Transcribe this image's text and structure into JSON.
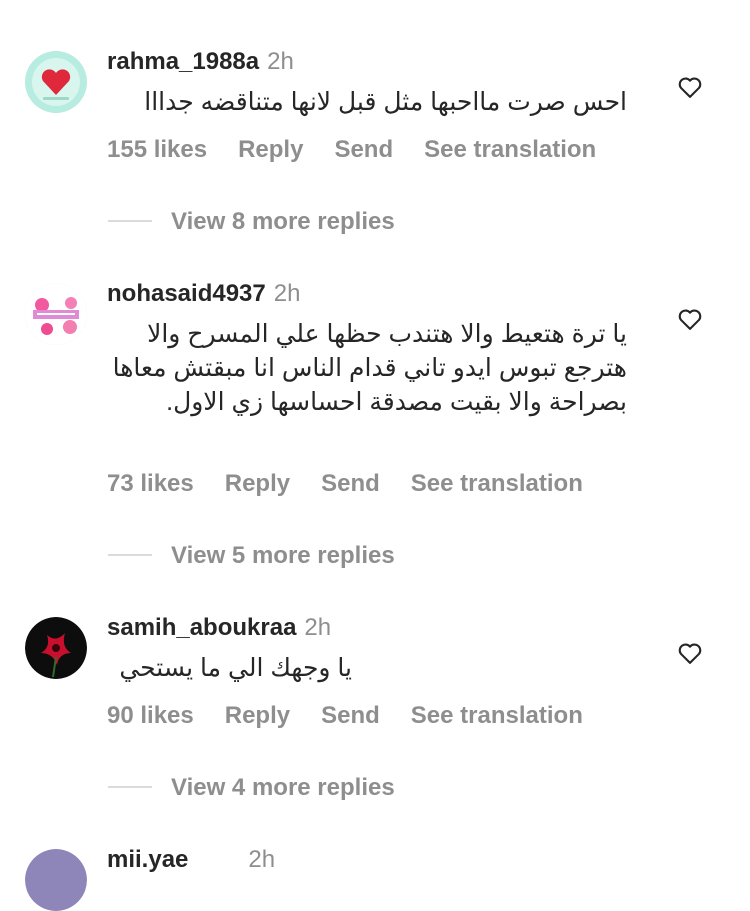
{
  "comments": [
    {
      "username": "rahma_1988a",
      "time": "2h",
      "text": "احس صرت مااحبها مثل قبل لانها متناقضه جدااا",
      "likes": "155 likes",
      "reply": "Reply",
      "send": "Send",
      "translate": "See translation",
      "view_replies": "View 8 more replies"
    },
    {
      "username": "nohasaid4937",
      "time": "2h",
      "text": "يا ترة هتعيط والا هتندب حظها علي المسرح والا هترجع تبوس ايدو تاني قدام الناس انا مبقتش معاها بصراحة والا بقيت مصدقة احساسها زي الاول.",
      "likes": "73 likes",
      "reply": "Reply",
      "send": "Send",
      "translate": "See translation",
      "view_replies": "View 5 more replies"
    },
    {
      "username": "samih_aboukraa",
      "time": "2h",
      "text": "يا وجهك الي ما يستحي",
      "likes": "90 likes",
      "reply": "Reply",
      "send": "Send",
      "translate": "See translation",
      "view_replies": "View 4 more replies"
    },
    {
      "username": "mii.yae",
      "time": "2h"
    }
  ],
  "icons": {
    "like": "heart-outline-icon"
  },
  "colors": {
    "text": "#262626",
    "secondary": "#8e8e8e",
    "divider": "#dbdbdb"
  }
}
